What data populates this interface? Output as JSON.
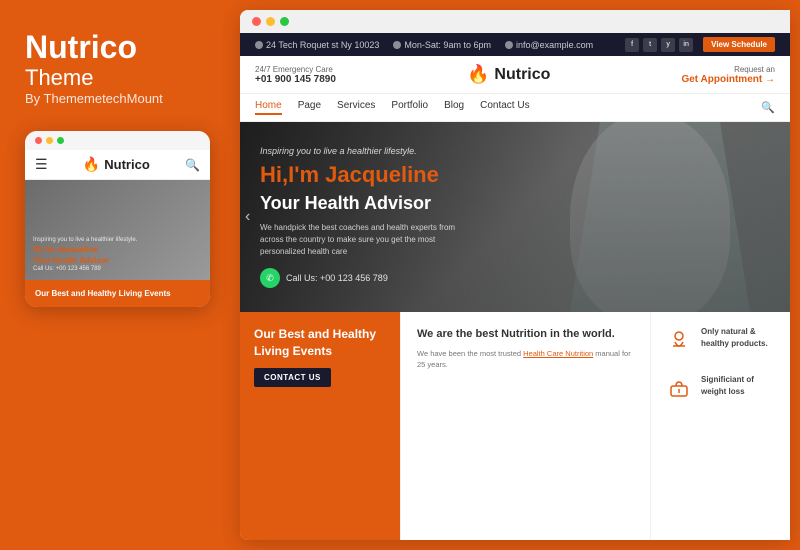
{
  "left": {
    "brand_name": "Nutrico",
    "brand_theme": "Theme",
    "brand_by": "By ThememetechMount",
    "mobile": {
      "dots": [
        "red",
        "yellow",
        "green"
      ],
      "logo": "Nutrico",
      "hero_small": "Inspiring you to live a healthier lifestyle.",
      "hero_heading_start": "Hi,I'm ",
      "hero_heading_name": "Jacqueline",
      "hero_heading_end": "Your Health Advisor",
      "hero_cta": "Call Us: +00 123 456 789",
      "bottom_text_start": "Our Best and Healthy ",
      "bottom_text_bold": "Living Events"
    }
  },
  "right": {
    "topbar": {
      "address": "24 Tech Roquet st Ny 10023",
      "hours": "Mon-Sat: 9am to 6pm",
      "email": "info@example.com",
      "social": [
        "f",
        "t",
        "y",
        "in"
      ],
      "schedule_btn": "View Schedule"
    },
    "main_nav": {
      "emergency_label": "24/7 Emergency Care",
      "phone": "+01 900 145 7890",
      "logo": "Nutrico",
      "request_label": "Request an",
      "appointment_label": "Get Appointment →"
    },
    "nav_menu": {
      "items": [
        "Home",
        "Page",
        "Services",
        "Portfolio",
        "Blog",
        "Contact Us"
      ],
      "active": "Home"
    },
    "hero": {
      "small_text": "Inspiring you to live a healthier lifestyle.",
      "heading_start": "Hi,I'm ",
      "heading_name": "Jacqueline",
      "subheading": "Your Health Advisor",
      "description": "We handpick the best coaches and health experts from across the country to make sure you get the most personalized health care",
      "cta_text": "Call Us: +00 123 456 789"
    },
    "bottom": {
      "events_title_start": "Our Best and Healthy ",
      "events_title_bold": "Living Events",
      "events_btn": "CONTACT US",
      "nutrition_heading_start": "We are the best Nutrition ",
      "nutrition_heading_bold": "in the world.",
      "nutrition_text_start": "We have been the most trusted ",
      "nutrition_link": "Health Care Nutrition",
      "nutrition_text_end": " manual for 25 years.",
      "feature1_text_start": "Only natural & ",
      "feature1_text_bold": "healthy products.",
      "feature2_text_start": "Significiant of ",
      "feature2_text_bold": "weight loss"
    }
  }
}
